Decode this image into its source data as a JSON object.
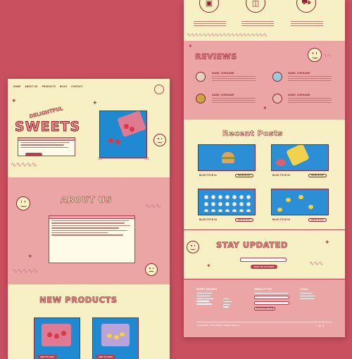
{
  "colors": {
    "background": "#c9505f",
    "cream": "#f7f0c4",
    "pink": "#eba5a5",
    "maroon": "#8b2432"
  },
  "left_page": {
    "nav": {
      "items": [
        "HOME",
        "ABOUT US",
        "PRODUCTS",
        "BLOG",
        "CONTACT"
      ]
    },
    "hero": {
      "kicker": "DELIGHTFUL",
      "title": "SWEETS"
    },
    "about": {
      "title": "ABOUT US"
    },
    "products": {
      "title": "NEW PRODUCTS",
      "add_to_cart": "ADD TO CART"
    }
  },
  "right_page": {
    "reviews": {
      "title": "REVIEWS",
      "items": [
        {
          "name": "NAME, SURNAME",
          "avatar_color": "#e4d3c0"
        },
        {
          "name": "NAME, SURNAME",
          "avatar_color": "#9cc9e0"
        },
        {
          "name": "NAME, SURNAME",
          "avatar_color": "#c9a645"
        },
        {
          "name": "NAME, SURNAME",
          "avatar_color": "#e7b8b0"
        }
      ]
    },
    "recent_posts": {
      "title": "Recent Posts",
      "read_button": "READ BLOG",
      "posts": [
        {
          "title": "BLOG TITLE 01"
        },
        {
          "title": "BLOG TITLE 02"
        },
        {
          "title": "BLOG TITLE 03"
        },
        {
          "title": "BLOG TITLE 04"
        }
      ]
    },
    "newsletter": {
      "title": "STAY UPDATED",
      "button": "VIEW COLLECTIONS"
    },
    "footer": {
      "brand": "SWEET DELIGHT",
      "newsletter_heading": "NEWSLETTER",
      "legal_heading": "LEGAL",
      "subscribe": "SUBSCRIBE NOW",
      "copyright": "Copyright 2023 · Sweet Delight · All Rights Reserved"
    }
  }
}
